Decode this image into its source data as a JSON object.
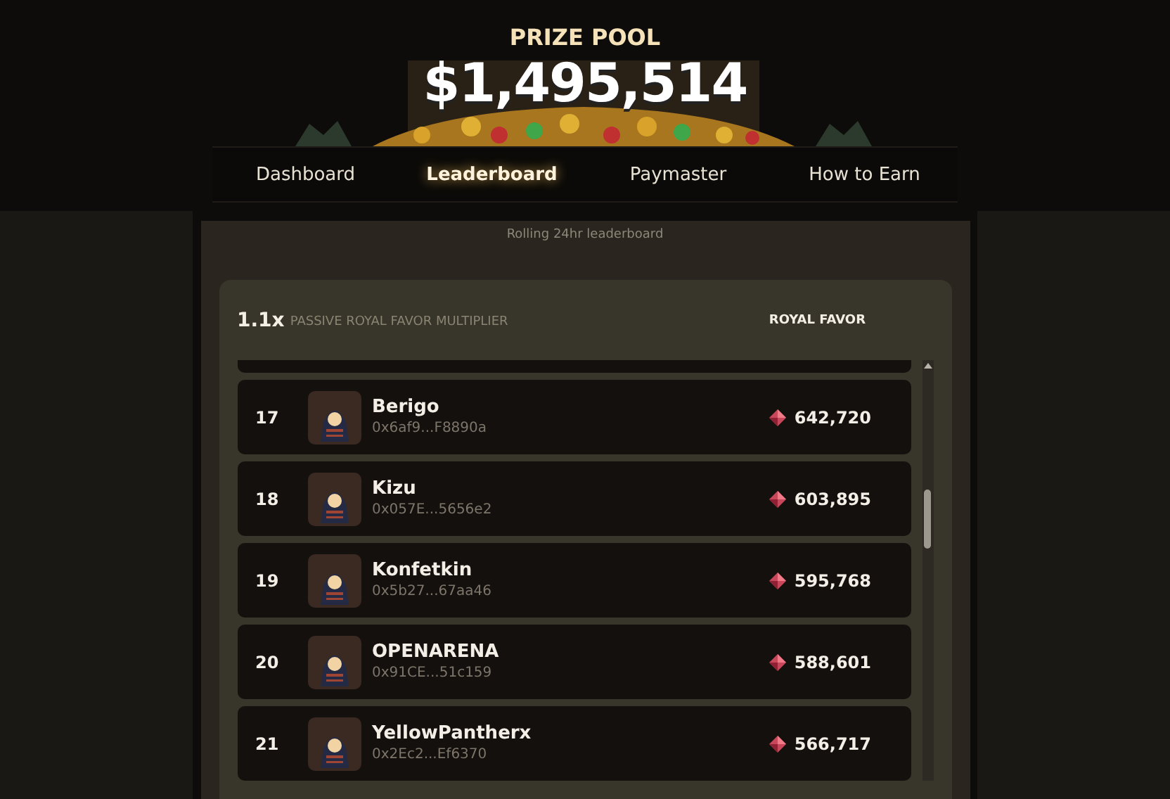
{
  "header": {
    "title": "PRIZE POOL",
    "amount": "$1,495,514"
  },
  "tabs": [
    {
      "label": "Dashboard",
      "selected": false
    },
    {
      "label": "Leaderboard",
      "selected": true
    },
    {
      "label": "Paymaster",
      "selected": false
    },
    {
      "label": "How to Earn",
      "selected": false
    }
  ],
  "subtitle": "Rolling 24hr leaderboard",
  "board": {
    "multiplier": "1.1x",
    "multiplier_label": "PASSIVE ROYAL FAVOR MULTIPLIER",
    "column": "ROYAL FAVOR",
    "rows": [
      {
        "rank": "17",
        "name": "Berigo",
        "address": "0x6af9...F8890a",
        "favor": "642,720"
      },
      {
        "rank": "18",
        "name": "Kizu",
        "address": "0x057E...5656e2",
        "favor": "603,895"
      },
      {
        "rank": "19",
        "name": "Konfetkin",
        "address": "0x5b27...67aa46",
        "favor": "595,768"
      },
      {
        "rank": "20",
        "name": "OPENARENA",
        "address": "0x91CE...51c159",
        "favor": "588,601"
      },
      {
        "rank": "21",
        "name": "YellowPantherx",
        "address": "0x2Ec2...Ef6370",
        "favor": "566,717"
      }
    ]
  }
}
